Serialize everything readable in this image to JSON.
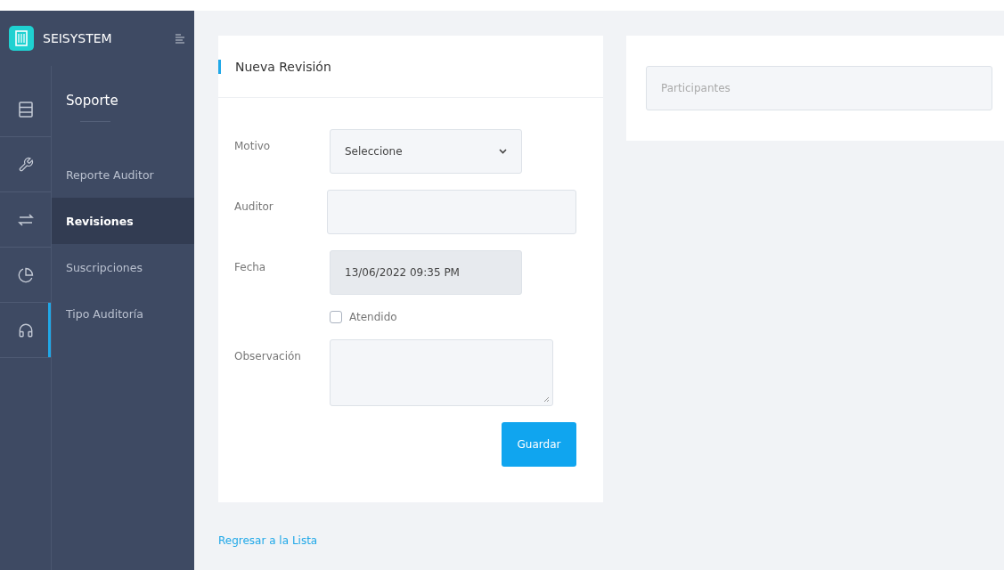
{
  "brand": {
    "name": "SEISYSTEM"
  },
  "rail": [
    {
      "kind": "server",
      "selected": false
    },
    {
      "kind": "wrench",
      "selected": false
    },
    {
      "kind": "arrows",
      "selected": false
    },
    {
      "kind": "pie",
      "selected": false
    },
    {
      "kind": "headset",
      "selected": true
    }
  ],
  "submenu": {
    "title": "Soporte",
    "items": [
      {
        "label": "Reporte Auditor",
        "selected": false
      },
      {
        "label": "Revisiones",
        "selected": true
      },
      {
        "label": "Suscripciones",
        "selected": false
      },
      {
        "label": "Tipo Auditoría",
        "selected": false
      }
    ]
  },
  "form": {
    "title": "Nueva Revisión",
    "fields": [
      {
        "label": "Motivo",
        "kind": "select",
        "value": "Seleccione",
        "disabled": false
      },
      {
        "label": "Auditor",
        "kind": "text",
        "disabled": false
      },
      {
        "label": "Fecha",
        "kind": "date",
        "value": "13/06/2022 09:35 PM",
        "disabled": true
      },
      {
        "label": "Atendido",
        "kind": "checkbox",
        "checked": false
      },
      {
        "label": "Observación",
        "kind": "textarea",
        "disabled": false
      }
    ],
    "button": "Guardar"
  },
  "back_link": "Regresar a la Lista",
  "participants": {
    "placeholder": "Participantes"
  }
}
